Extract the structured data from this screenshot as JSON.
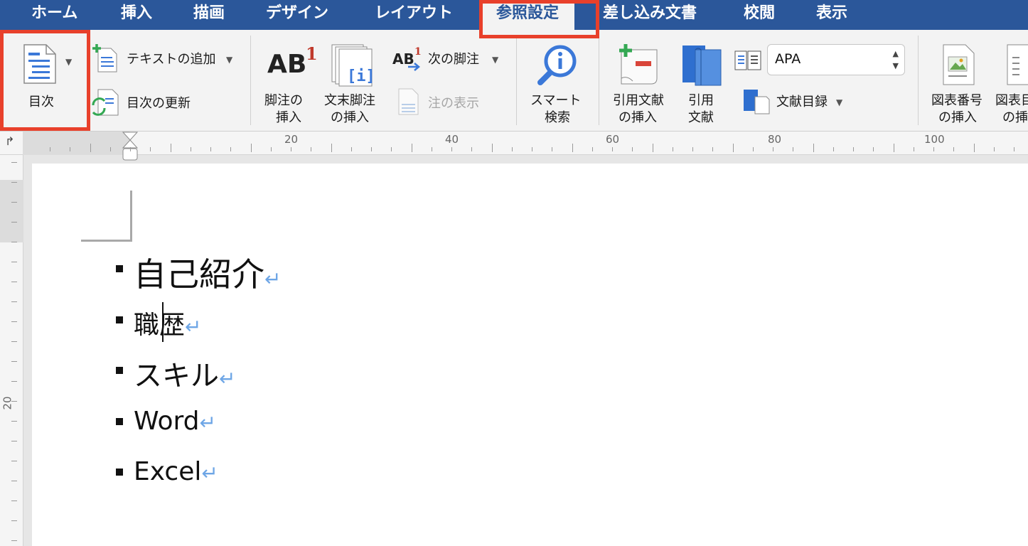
{
  "tabs": [
    "ホーム",
    "挿入",
    "描画",
    "デザイン",
    "レイアウト",
    "参照設定",
    "差し込み文書",
    "校閲",
    "表示"
  ],
  "ribbon": {
    "toc": "目次",
    "add_text": "テキストの追加",
    "update_toc": "目次の更新",
    "insert_footnote_1": "脚注の",
    "insert_footnote_2": "挿入",
    "insert_endnote_1": "文末脚注",
    "insert_endnote_2": "の挿入",
    "next_footnote": "次の脚注",
    "show_notes": "注の表示",
    "smart_lookup_1": "スマート",
    "smart_lookup_2": "検索",
    "insert_citation_1": "引用文献",
    "insert_citation_2": "の挿入",
    "citations_1": "引用",
    "citations_2": "文献",
    "style_value": "APA",
    "bibliography": "文献目録",
    "insert_caption_1": "図表番号",
    "insert_caption_2": "の挿入",
    "insert_tof_1": "図表目",
    "insert_tof_2": "の挿"
  },
  "ruler": {
    "marks": [
      "20",
      "40",
      "60",
      "80",
      "100"
    ],
    "vertical_mark": "20"
  },
  "document": {
    "items": [
      "自己紹介",
      "職歴",
      "スキル",
      "Word",
      "Excel"
    ]
  },
  "colors": {
    "accent": "#2b579a",
    "highlight": "#e8402b"
  }
}
